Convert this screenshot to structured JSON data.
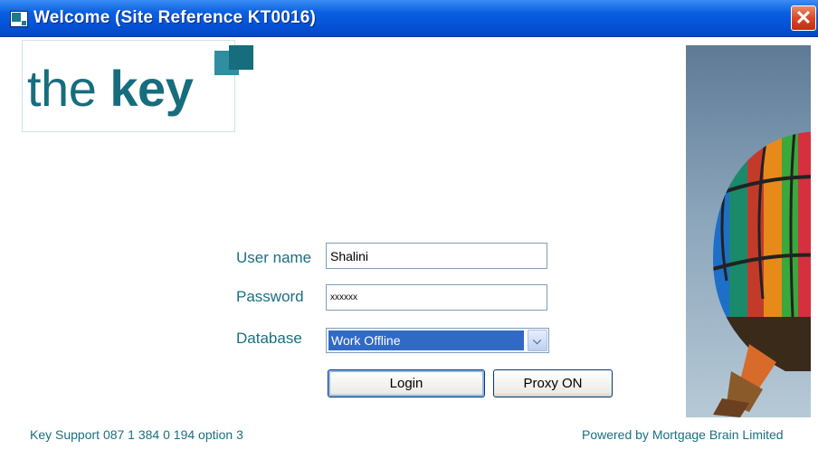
{
  "window": {
    "title": "Welcome (Site Reference KT0016)",
    "close_glyph": "✕",
    "titlebar_color": "#0452d6"
  },
  "logo": {
    "word_thin": "the ",
    "word_bold": "key",
    "color": "#176d7e"
  },
  "form": {
    "username_label": "User name",
    "username_value": "Shalini",
    "password_label": "Password",
    "password_value": "xxxxxx",
    "database_label": "Database",
    "database_selected": "Work Offline",
    "dropdown_icon": "chevron-down-icon"
  },
  "buttons": {
    "login": "Login",
    "proxy": "Proxy ON"
  },
  "footer": {
    "support": "Key Support 087 1 384 0 194 option 3",
    "powered_by": "Powered by Mortgage Brain Limited"
  },
  "accent_color": "#1a6f80"
}
